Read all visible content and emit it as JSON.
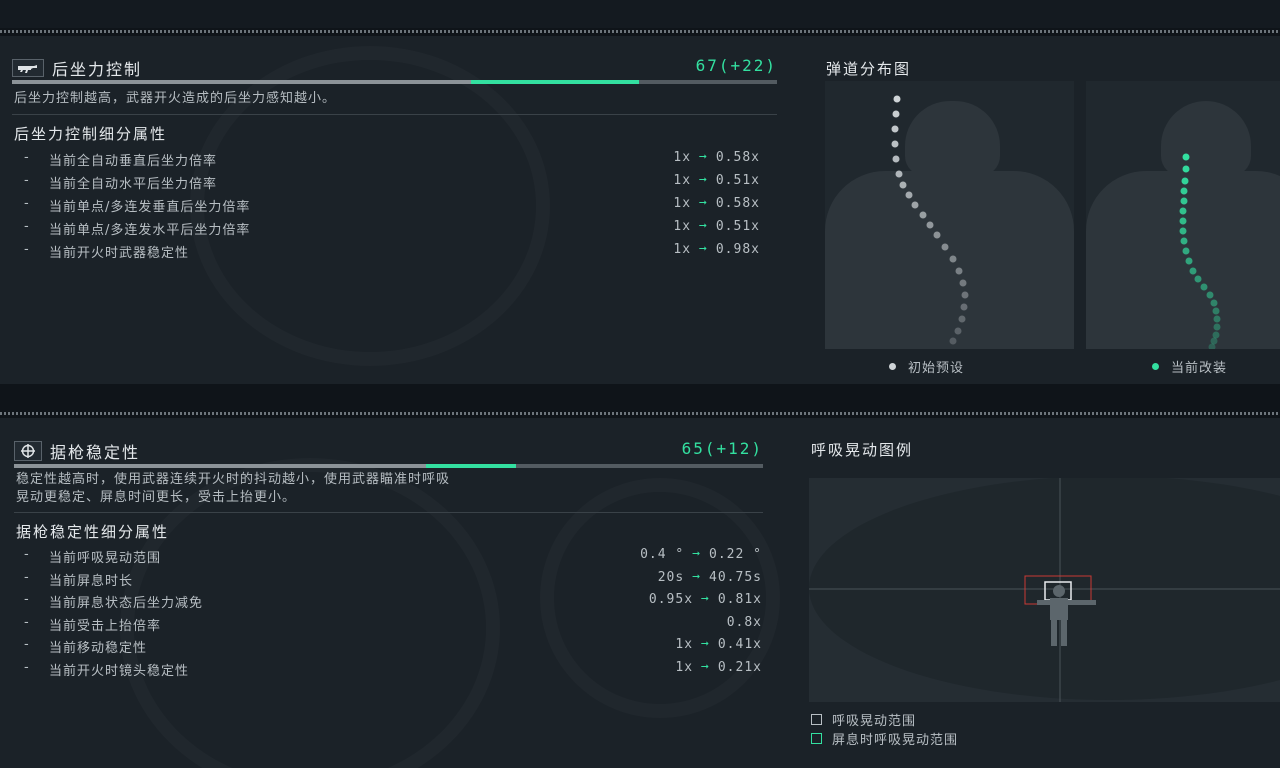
{
  "recoil": {
    "title": "后坐力控制",
    "icon": "rifle-icon",
    "score": "67(+22)",
    "base_level": 0.6,
    "bonus_level": 0.22,
    "description": "后坐力控制越高，武器开火造成的后坐力感知越小。",
    "sub_title": "后坐力控制细分属性",
    "rows": [
      {
        "dash": "-",
        "label": "当前全自动垂直后坐力倍率",
        "from": "1x",
        "to": "0.58x"
      },
      {
        "dash": "-",
        "label": "当前全自动水平后坐力倍率",
        "from": "1x",
        "to": "0.51x"
      },
      {
        "dash": "-",
        "label": "当前单点/多连发垂直后坐力倍率",
        "from": "1x",
        "to": "0.58x"
      },
      {
        "dash": "-",
        "label": "当前单点/多连发水平后坐力倍率",
        "from": "1x",
        "to": "0.51x"
      },
      {
        "dash": "-",
        "label": "当前开火时武器稳定性",
        "from": "1x",
        "to": "0.98x"
      }
    ],
    "chart_title": "弹道分布图",
    "legend_default": "初始预设",
    "legend_current": "当前改装"
  },
  "stability": {
    "title": "据枪稳定性",
    "icon": "crosshair-icon",
    "score": "65(+12)",
    "base_level": 0.55,
    "bonus_level": 0.12,
    "description_line1": "稳定性越高时，使用武器连续开火时的抖动越小，使用武器瞄准时呼吸",
    "description_line2": "晃动更稳定、屏息时间更长，受击上抬更小。",
    "sub_title": "据枪稳定性细分属性",
    "rows": [
      {
        "dash": "-",
        "label": "当前呼吸晃动范围",
        "from": "0.4 °",
        "to": "0.22 °"
      },
      {
        "dash": "-",
        "label": "当前屏息时长",
        "from": "20s",
        "to": "40.75s"
      },
      {
        "dash": "-",
        "label": "当前屏息状态后坐力减免",
        "from": "0.95x",
        "to": "0.81x"
      },
      {
        "dash": "-",
        "label": "当前受击上抬倍率",
        "from": "",
        "to": "0.8x"
      },
      {
        "dash": "-",
        "label": "当前移动稳定性",
        "from": "1x",
        "to": "0.41x"
      },
      {
        "dash": "-",
        "label": "当前开火时镜头稳定性",
        "from": "1x",
        "to": "0.21x"
      }
    ],
    "chart_title": "呼吸晃动图例",
    "legend_range": "呼吸晃动范围",
    "legend_hold": "屏息时呼吸晃动范围"
  },
  "colors": {
    "accent": "#33e0a0",
    "default_dot": "#cfd4d7",
    "panel": "#1b2228"
  }
}
